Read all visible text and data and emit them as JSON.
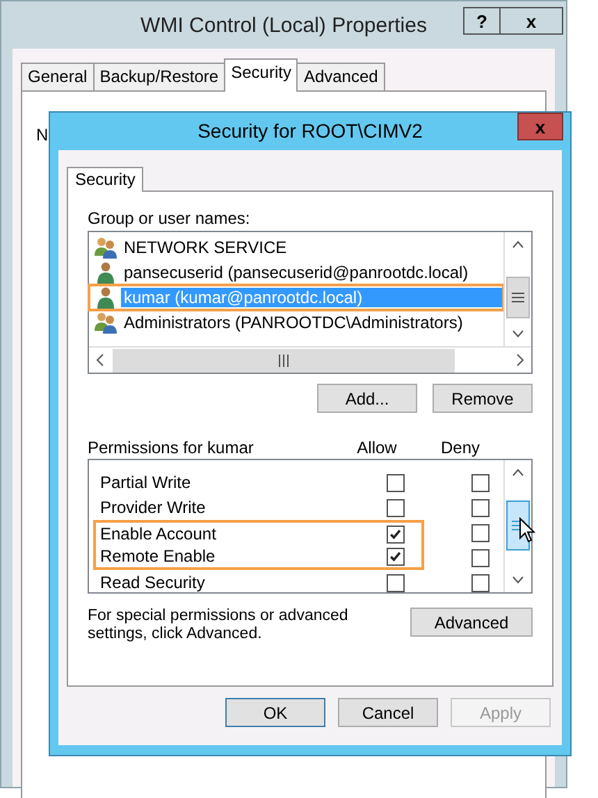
{
  "back_window": {
    "title": "WMI Control (Local) Properties",
    "title_buttons": [
      "?",
      "x"
    ],
    "tabs": [
      {
        "label": "General",
        "selected": false
      },
      {
        "label": "Backup/Restore",
        "selected": false
      },
      {
        "label": "Security",
        "selected": true
      },
      {
        "label": "Advanced",
        "selected": false
      }
    ],
    "panel_text": "N"
  },
  "dialog": {
    "title": "Security for ROOT\\CIMV2",
    "close": "x",
    "tabs": [
      {
        "label": "Security",
        "selected": true
      }
    ],
    "users_label": "Group or user names:",
    "users": [
      {
        "name": "NETWORK SERVICE",
        "kind": "group",
        "selected": false,
        "highlighted": false
      },
      {
        "name": "pansecuserid (pansecuserid@panrootdc.local)",
        "kind": "user",
        "selected": false,
        "highlighted": false
      },
      {
        "name": "kumar (kumar@panrootdc.local)",
        "kind": "user",
        "selected": true,
        "highlighted": true
      },
      {
        "name": "Administrators (PANROOTDC\\Administrators)",
        "kind": "group",
        "selected": false,
        "highlighted": false
      }
    ],
    "user_buttons": [
      "Add...",
      "Remove"
    ],
    "permissions_label": "Permissions for kumar",
    "allow_header": "Allow",
    "deny_header": "Deny",
    "permissions": [
      {
        "name": "Partial Write",
        "allow": false,
        "deny": false,
        "highlighted": false
      },
      {
        "name": "Provider Write",
        "allow": false,
        "deny": false,
        "highlighted": false
      },
      {
        "name": "Enable Account",
        "allow": true,
        "deny": false,
        "highlighted": true
      },
      {
        "name": "Remote Enable",
        "allow": true,
        "deny": false,
        "highlighted": true
      },
      {
        "name": "Read Security",
        "allow": false,
        "deny": false,
        "highlighted": false
      }
    ],
    "advanced_note": "For special permissions or advanced settings, click Advanced.",
    "advanced_button": "Advanced",
    "buttons": [
      {
        "label": "OK",
        "disabled": false,
        "default": true
      },
      {
        "label": "Cancel",
        "disabled": false,
        "default": false
      },
      {
        "label": "Apply",
        "disabled": true,
        "default": false
      }
    ]
  }
}
